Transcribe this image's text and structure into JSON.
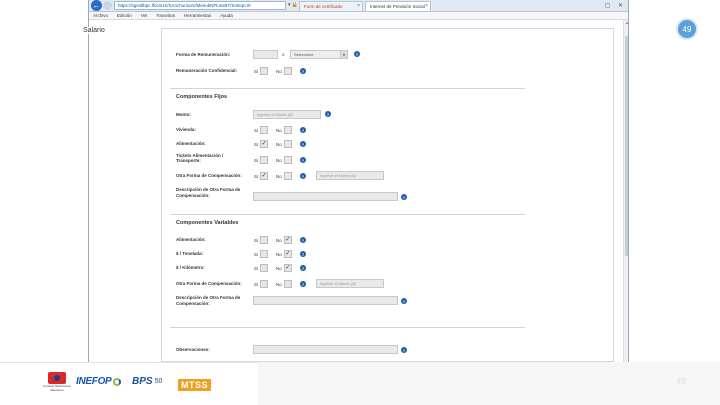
{
  "slide": {
    "page_number": "49",
    "ghost_number": "49"
  },
  "browser": {
    "url": "https://sgestlbpc.lfocsUX/SAnchurisom/MenubNFlonsBT/Soleqn:rtl",
    "url_tools": "▾ 🔒 ⟳ ✕",
    "tabs": [
      {
        "label": "Form de certificado"
      },
      {
        "label": "Internet de Previsión Social"
      }
    ],
    "window_controls": "▢ ✕",
    "menu": [
      "Archivo",
      "Edición",
      "Ver",
      "Favoritos",
      "Herramientas",
      "Ayuda"
    ]
  },
  "form": {
    "legend": "Salario",
    "forma_remuneracion_label": "Forma de Remuneración:",
    "forma_remuneracion_sep": "o",
    "forma_select_value": "Seleccione",
    "remuneracion_confidencial_label": "Remuneración Confidencial:",
    "si": "Si",
    "no": "No",
    "check": "✓",
    "help_glyph": "?",
    "fijos_title": "Componentes Fijos",
    "monto_label": "Monto:",
    "monto_placeholder": "Ingrese el Monto ($)",
    "vivienda_label": "Vivienda:",
    "alimentacion_label": "Alimentación:",
    "tickets_label_1": "Tickets Alimentación /",
    "tickets_label_2": "Transporte:",
    "otra_forma_label": "Otra Forma de Compensación:",
    "otra_monto_placeholder": "Ingrese el Monto ($)",
    "descripcion_label_1": "Descripción de Otra Forma de",
    "descripcion_label_2": "Compensación:",
    "variables_title": "Componentes Variables",
    "var_alimentacion_label": "Alimentación:",
    "tonelada_label": "$ / Tonelada:",
    "kilometro_label": "$ / Kilómetro:",
    "observaciones_label": "Observaciones:"
  },
  "footer": {
    "cnm_text": "Consejo Nacional de Monitoreo",
    "inefop": "INEFOP",
    "bps": "BPS",
    "bps_num": "50",
    "mtss": "MTSS"
  },
  "colors": {
    "accent_blue": "#1f5ea8",
    "page_badge": "#5d9fd6",
    "mtss_orange": "#f0a020"
  }
}
